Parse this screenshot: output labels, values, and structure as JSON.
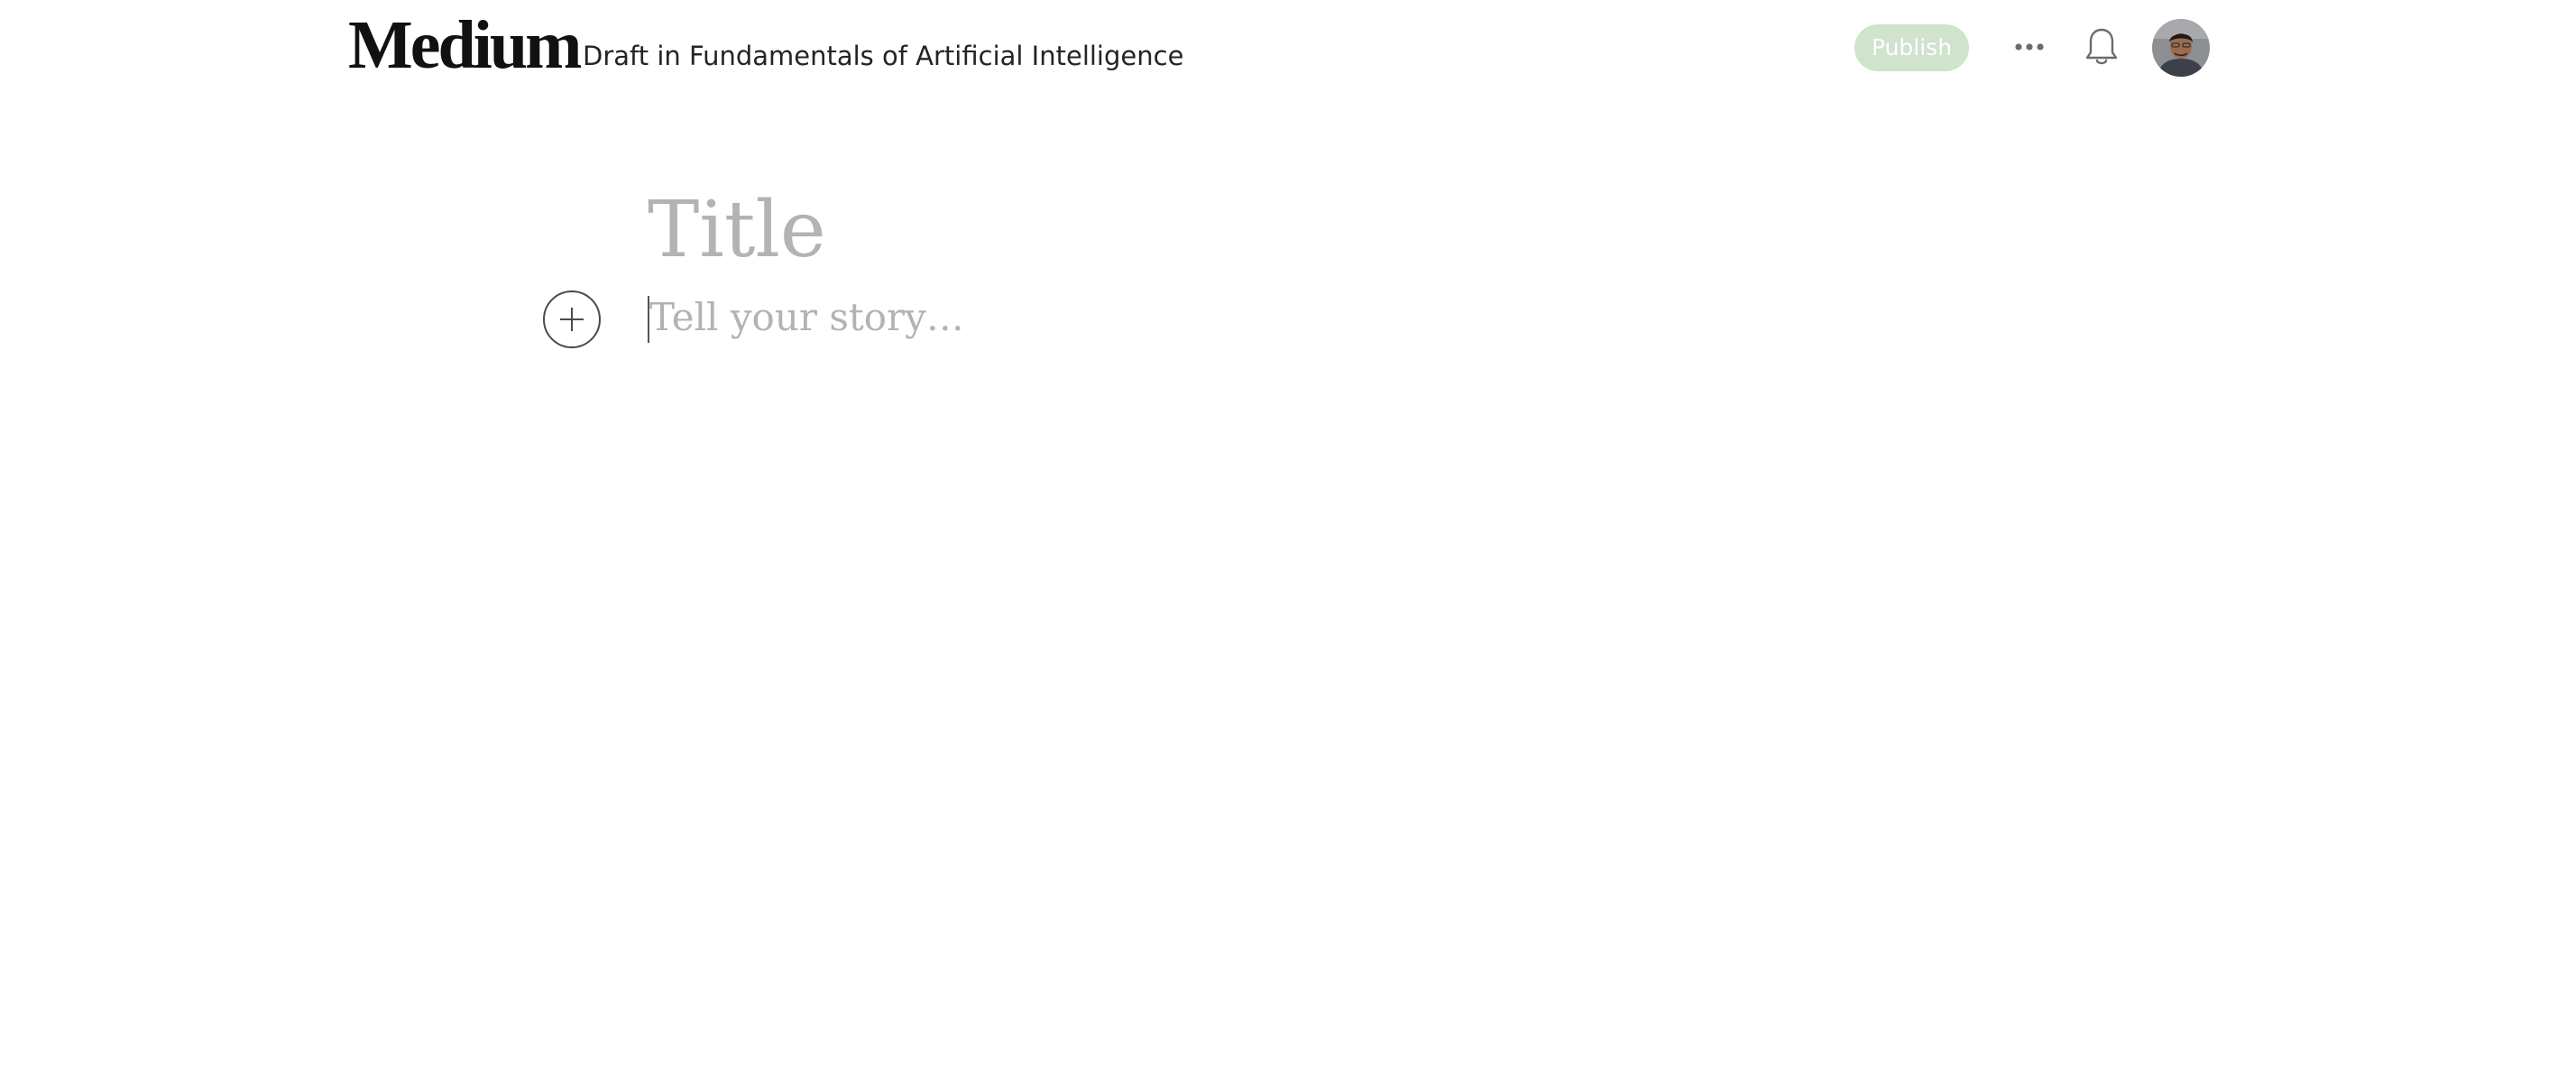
{
  "header": {
    "logo_text": "Medium",
    "draft_label": "Draft in Fundamentals of Artificial Intelligence",
    "publish_label": "Publish",
    "more_icon": "more-horizontal-icon",
    "notifications_icon": "bell-icon",
    "avatar_alt": "User avatar"
  },
  "editor": {
    "title_placeholder": "Title",
    "title_value": "",
    "story_placeholder": "Tell your story…",
    "story_value": "",
    "add_icon": "plus-circle-icon"
  },
  "colors": {
    "publish_bg": "#cfe3cd",
    "placeholder": "#b3b3b3",
    "text": "#242424"
  }
}
